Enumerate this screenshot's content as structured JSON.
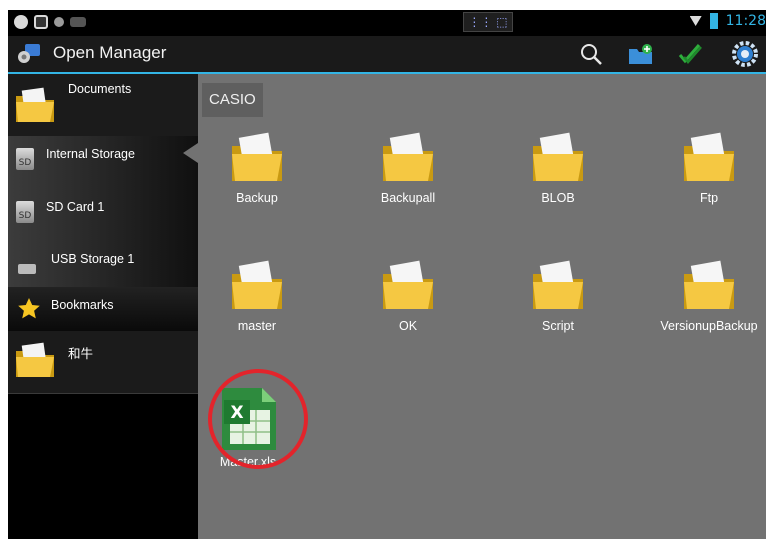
{
  "status_bar": {
    "center_label": "⋮⋮ ⬚ ∨",
    "clock": "11:28"
  },
  "header": {
    "title": "Open Manager",
    "actions": [
      "search-icon",
      "new-folder-icon",
      "multi-select-icon",
      "settings-icon"
    ]
  },
  "sidebar": {
    "items": [
      {
        "label": "Documents",
        "icon": "folder-icon"
      },
      {
        "label": "Internal Storage",
        "icon": "sd-card-icon",
        "icon_text": "SD"
      },
      {
        "label": "SD Card 1",
        "icon": "sd-card-icon",
        "icon_text": "SD"
      },
      {
        "label": "USB Storage 1",
        "icon": "usb-icon"
      },
      {
        "label": "Bookmarks",
        "icon": "star-icon"
      },
      {
        "label": "和牛",
        "icon": "folder-icon"
      }
    ]
  },
  "main": {
    "breadcrumb": "CASIO",
    "folders": [
      "Backup",
      "Backupall",
      "BLOB",
      "Ftp",
      "master",
      "OK",
      "Script",
      "VersionupBackup"
    ],
    "files": [
      {
        "name": "Master.xls",
        "icon": "excel-file-icon",
        "highlighted": true
      }
    ]
  },
  "colors": {
    "accent": "#33b5e5",
    "content_bg": "#727272",
    "folder": "#f5c842",
    "highlight": "#e3242b"
  }
}
